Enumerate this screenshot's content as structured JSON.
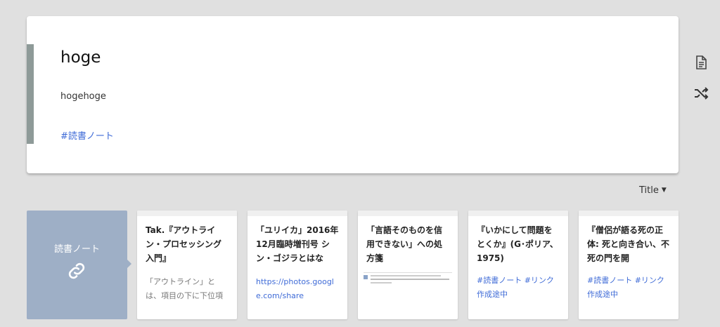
{
  "page": {
    "title": "hoge",
    "body": "hogehoge",
    "tag": "#読書ノート"
  },
  "side_actions": [
    {
      "icon": "document-icon"
    },
    {
      "icon": "shuffle-icon"
    }
  ],
  "sort": {
    "label": "Title"
  },
  "link_card": {
    "label": "読書ノート",
    "icon": "link-icon"
  },
  "cards": [
    {
      "title": "Tak.『アウトライン・プロセッシング入門』",
      "excerpt": "「アウトライン」とは、項目の下に下位項目を、下位"
    },
    {
      "title": "「ユリイカ」2016年12月臨時増刊号 シン・ゴジラとはな",
      "url": "https://photos.google.com/share"
    },
    {
      "title": "「言語そのものを信用できない」への処方箋"
    },
    {
      "title": "『いかにして問題をとくか』(G･ポリア、1975)",
      "tags": "#読書ノート #リンク作成途中"
    },
    {
      "title": "『僧侶が語る死の正体: 死と向き合い、不死の門を開",
      "tags": "#読書ノート #リンク作成途中"
    }
  ]
}
